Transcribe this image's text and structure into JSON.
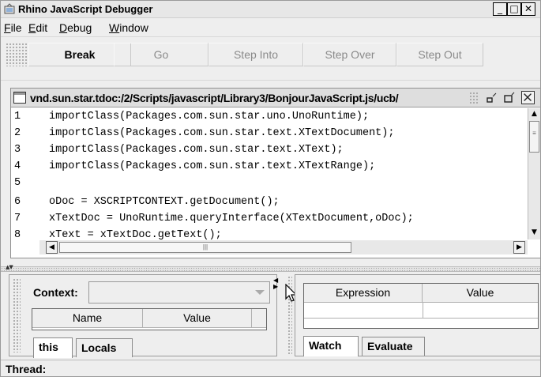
{
  "window": {
    "title": "Rhino JavaScript Debugger",
    "controls": {
      "minimize": "_",
      "maximize": "□",
      "close": "✕"
    }
  },
  "menu": {
    "items": [
      {
        "label": "File"
      },
      {
        "label": "Edit"
      },
      {
        "label": "Debug"
      },
      {
        "label": "Window"
      }
    ]
  },
  "toolbar": {
    "buttons": [
      {
        "label": "Break",
        "enabled": true
      },
      {
        "label": "Go",
        "enabled": false
      },
      {
        "label": "Step Into",
        "enabled": false
      },
      {
        "label": "Step Over",
        "enabled": false
      },
      {
        "label": "Step Out",
        "enabled": false
      }
    ]
  },
  "editor": {
    "title": "vnd.sun.star.tdoc:/2/Scripts/javascript/Library3/BonjourJavaScript.js/ucb/",
    "lines": [
      {
        "n": "1",
        "text": "importClass(Packages.com.sun.star.uno.UnoRuntime);"
      },
      {
        "n": "2",
        "text": "importClass(Packages.com.sun.star.text.XTextDocument);"
      },
      {
        "n": "3",
        "text": "importClass(Packages.com.sun.star.text.XText);"
      },
      {
        "n": "4",
        "text": "importClass(Packages.com.sun.star.text.XTextRange);"
      },
      {
        "n": "5",
        "text": ""
      },
      {
        "n": "6",
        "text": "oDoc = XSCRIPTCONTEXT.getDocument();"
      },
      {
        "n": "7",
        "text": "xTextDoc = UnoRuntime.queryInterface(XTextDocument,oDoc);"
      },
      {
        "n": "8",
        "text": "xText = xTextDoc.getText();"
      }
    ]
  },
  "context_panel": {
    "label": "Context:",
    "combo_value": "",
    "columns": [
      "Name",
      "Value"
    ],
    "tabs": [
      "this",
      "Locals"
    ]
  },
  "watch_panel": {
    "columns": [
      "Expression",
      "Value"
    ],
    "tabs": [
      "Watch",
      "Evaluate"
    ]
  },
  "status": {
    "thread_label": "Thread:"
  },
  "colors": {
    "background": "#eeeeee",
    "disabled_text": "#8a8a8a",
    "border": "#9a9a9a"
  }
}
